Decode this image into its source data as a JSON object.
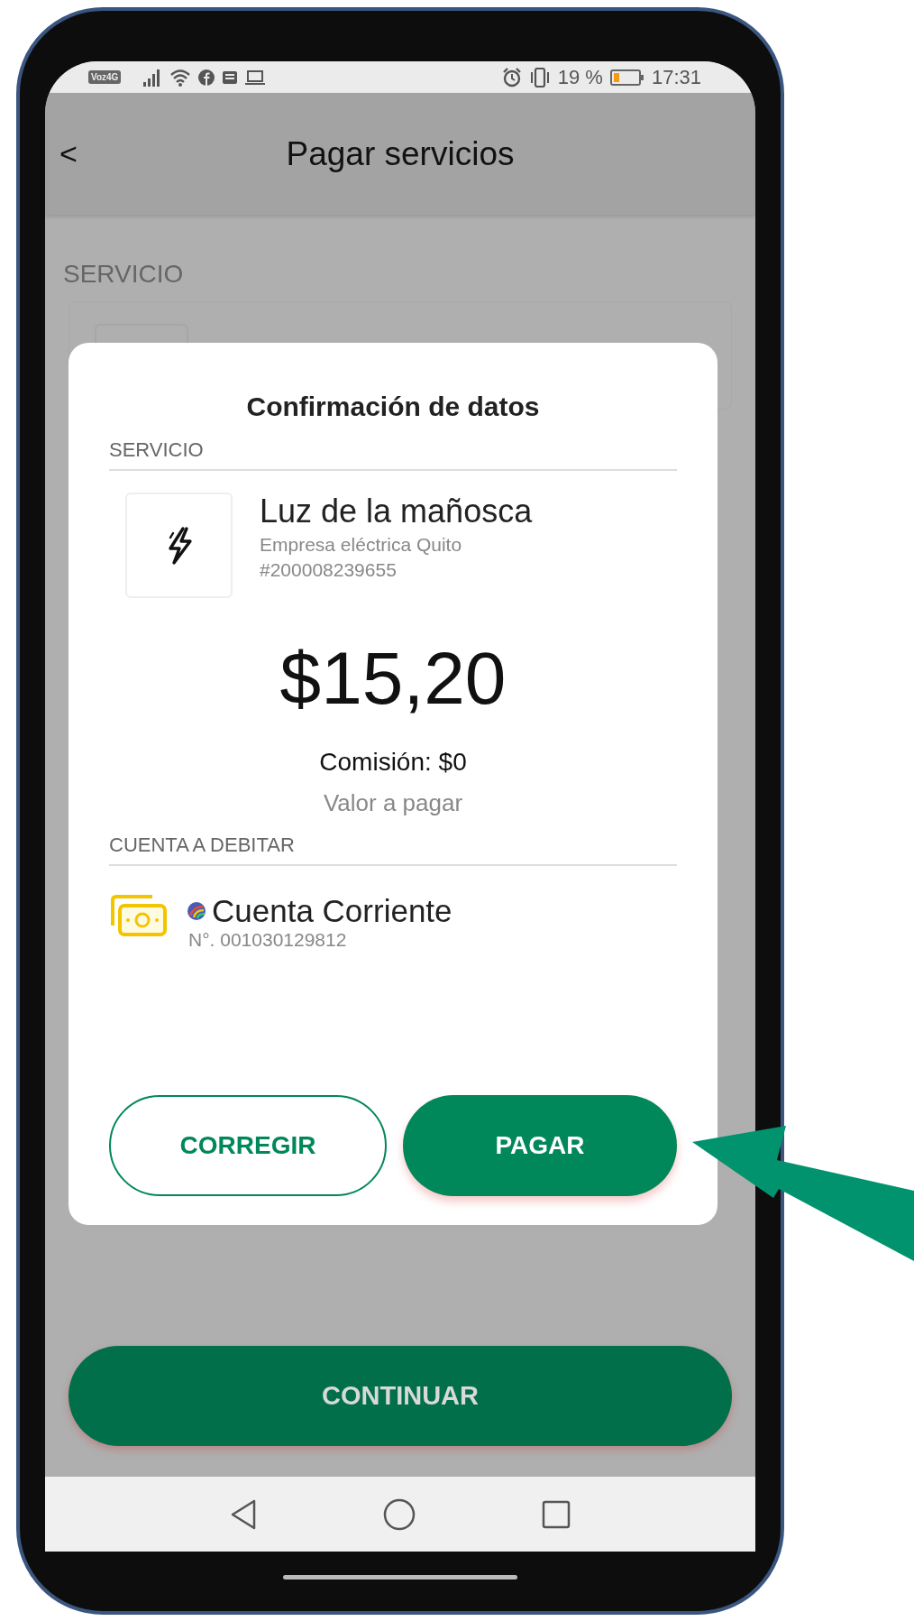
{
  "status_bar": {
    "carrier_badge": "Voz4G",
    "battery": "19 %",
    "time": "17:31"
  },
  "header": {
    "back": "<",
    "title": "Pagar servicios"
  },
  "background": {
    "section_label": "SERVICIO",
    "button": "CONTINUAR"
  },
  "dialog": {
    "title": "Confirmación de datos",
    "service_label": "SERVICIO",
    "service": {
      "name": "Luz de la mañosca",
      "company": "Empresa eléctrica Quito",
      "number": "#200008239655"
    },
    "amount": "$15,20",
    "commission": "Comisión: $0",
    "amount_caption": "Valor a pagar",
    "account_label": "CUENTA A DEBITAR",
    "account": {
      "name": "Cuenta Corriente",
      "number": "N°. 001030129812"
    },
    "buttons": [
      {
        "label": "CORREGIR",
        "kind": "outline"
      },
      {
        "label": "PAGAR",
        "kind": "filled"
      }
    ]
  }
}
